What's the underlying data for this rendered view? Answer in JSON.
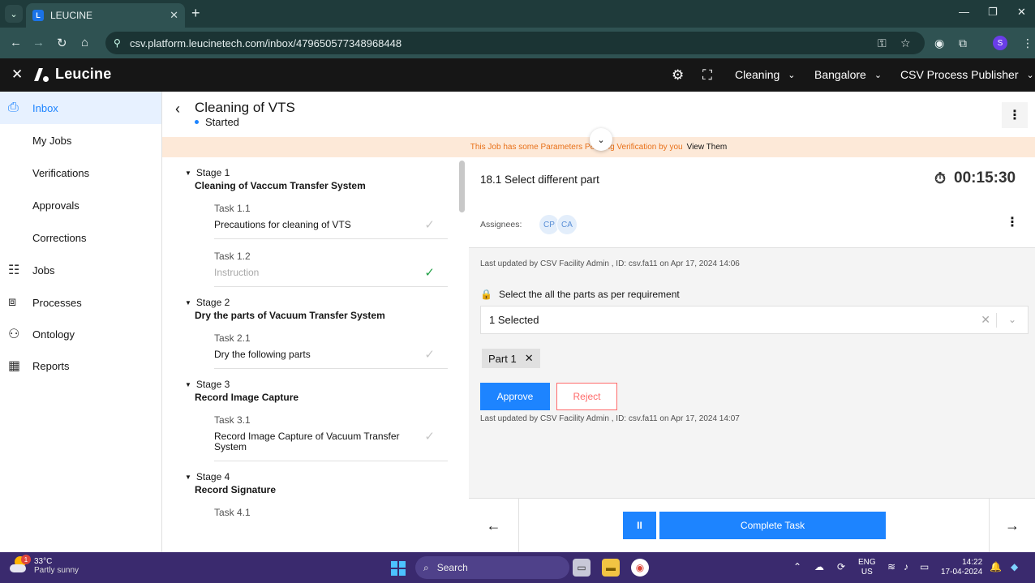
{
  "browser": {
    "tab_title": "LEUCINE",
    "tab_favicon": "L",
    "url": "csv.platform.leucinetech.com/inbox/479650577348968448",
    "profile_initial": "S"
  },
  "header": {
    "brand": "Leucine",
    "facility_dropdown": "Cleaning",
    "location_dropdown": "Bangalore",
    "role_dropdown": "CSV Process Publisher"
  },
  "sidebar": {
    "items": [
      {
        "label": "Inbox"
      },
      {
        "label": "My Jobs"
      },
      {
        "label": "Verifications"
      },
      {
        "label": "Approvals"
      },
      {
        "label": "Corrections"
      },
      {
        "label": "Jobs"
      },
      {
        "label": "Processes"
      },
      {
        "label": "Ontology"
      },
      {
        "label": "Reports"
      }
    ]
  },
  "job": {
    "title": "Cleaning of VTS",
    "status": "Started"
  },
  "banner": {
    "message": "This Job has some Parameters Pending Verification by you",
    "link": "View Them"
  },
  "stages": [
    {
      "number": "Stage 1",
      "name": "Cleaning of Vaccum Transfer System",
      "tasks": [
        {
          "number": "Task 1.1",
          "name": "Precautions for cleaning of VTS",
          "state": "pending"
        },
        {
          "number": "Task 1.2",
          "name": "Instruction",
          "state": "done"
        }
      ]
    },
    {
      "number": "Stage 2",
      "name": "Dry the parts of Vacuum Transfer System",
      "tasks": [
        {
          "number": "Task 2.1",
          "name": "Dry the following parts",
          "state": "pending"
        }
      ]
    },
    {
      "number": "Stage 3",
      "name": "Record Image Capture",
      "tasks": [
        {
          "number": "Task 3.1",
          "name": "Record Image Capture of Vacuum Transfer System",
          "state": "pending"
        }
      ]
    },
    {
      "number": "Stage 4",
      "name": "Record Signature",
      "tasks": [
        {
          "number": "Task 4.1",
          "name": "",
          "state": "pending"
        }
      ]
    }
  ],
  "task_panel": {
    "title": "18.1 Select different part",
    "timer": "00:15:30",
    "assignees_label": "Assignees:",
    "assignees": [
      "CP",
      "CA"
    ],
    "last_updated_top": "Last updated by CSV Facility Admin , ID: csv.fa11 on Apr 17, 2024 14:06",
    "parameter_label": "Select the all the parts as per requirement",
    "select_value": "1 Selected",
    "chip": "Part 1",
    "approve_label": "Approve",
    "reject_label": "Reject",
    "last_updated_bottom": "Last updated by CSV Facility Admin , ID: csv.fa11 on Apr 17, 2024 14:07"
  },
  "footer": {
    "pause_label": "II",
    "complete_label": "Complete Task"
  },
  "taskbar": {
    "temp": "33°C",
    "weather": "Partly sunny",
    "weather_badge": "1",
    "search": "Search",
    "lang_line1": "ENG",
    "lang_line2": "US",
    "time": "14:22",
    "date": "17-04-2024"
  },
  "colors": {
    "primary": "#1d84ff",
    "reject": "#ff6b6b",
    "banner_bg": "#fde9d8",
    "banner_text": "#e8711a",
    "success": "#24a148"
  }
}
